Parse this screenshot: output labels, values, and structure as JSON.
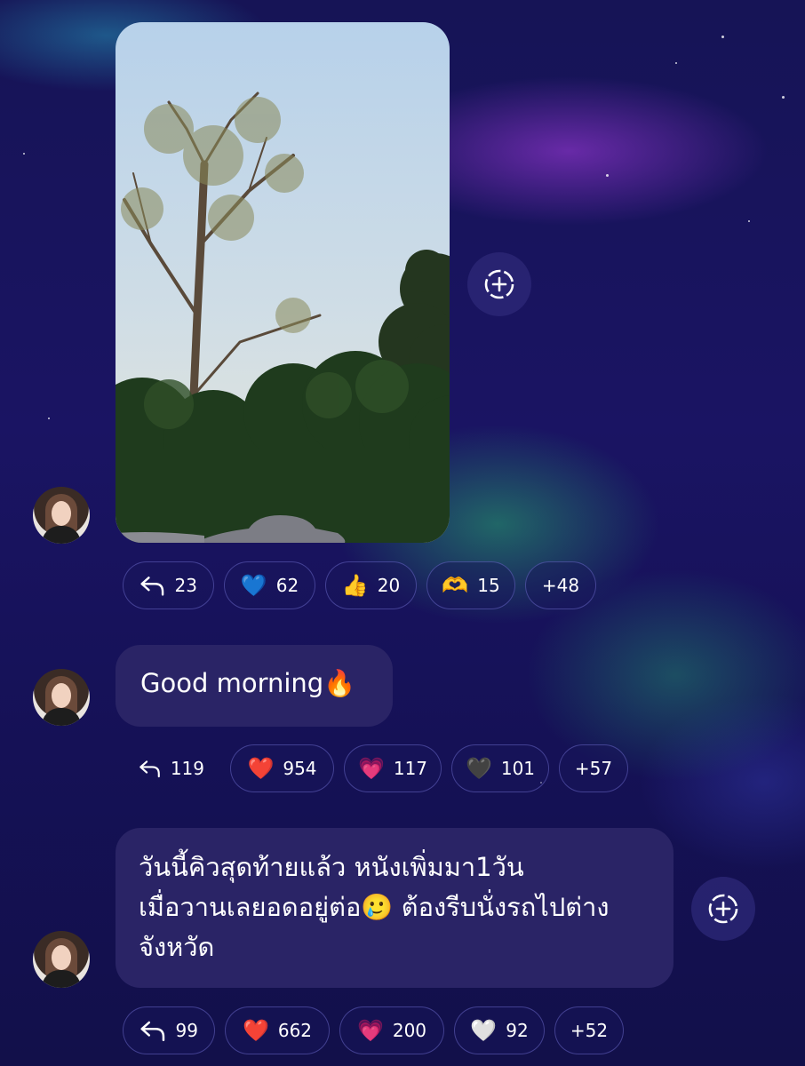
{
  "messages": [
    {
      "type": "image",
      "image_alt": "Trees against a pale blue sky with an elephant statue at the bottom",
      "reactions": {
        "reply_count": "23",
        "items": [
          {
            "emoji": "💙",
            "count": "62"
          },
          {
            "emoji": "👍",
            "count": "20"
          },
          {
            "emoji": "🫶",
            "count": "15"
          }
        ],
        "more": "+48"
      }
    },
    {
      "type": "text",
      "text": "Good morning🔥",
      "reactions": {
        "reply_count": "119",
        "items": [
          {
            "emoji": "❤️",
            "count": "954"
          },
          {
            "emoji": "💗",
            "count": "117"
          },
          {
            "emoji": "🖤",
            "count": "101"
          }
        ],
        "more": "+57"
      }
    },
    {
      "type": "text",
      "text": "วันนี้คิวสุดท้ายแล้ว หนังเพิ่มมา1วัน\nเมื่อวานเลยอดอยู่ต่อ🥲  ต้องรีบนั่งรถไปต่าง\nจังหวัด",
      "reactions": {
        "reply_count": "99",
        "items": [
          {
            "emoji": "❤️",
            "count": "662"
          },
          {
            "emoji": "💗",
            "count": "200"
          },
          {
            "emoji": "🤍",
            "count": "92"
          }
        ],
        "more": "+52"
      }
    }
  ],
  "icons": {
    "reply": "reply-arrow-icon",
    "add_reaction": "add-reaction-icon"
  },
  "colors": {
    "bubble": "#2a2466",
    "chip_border": "#7878dc"
  }
}
